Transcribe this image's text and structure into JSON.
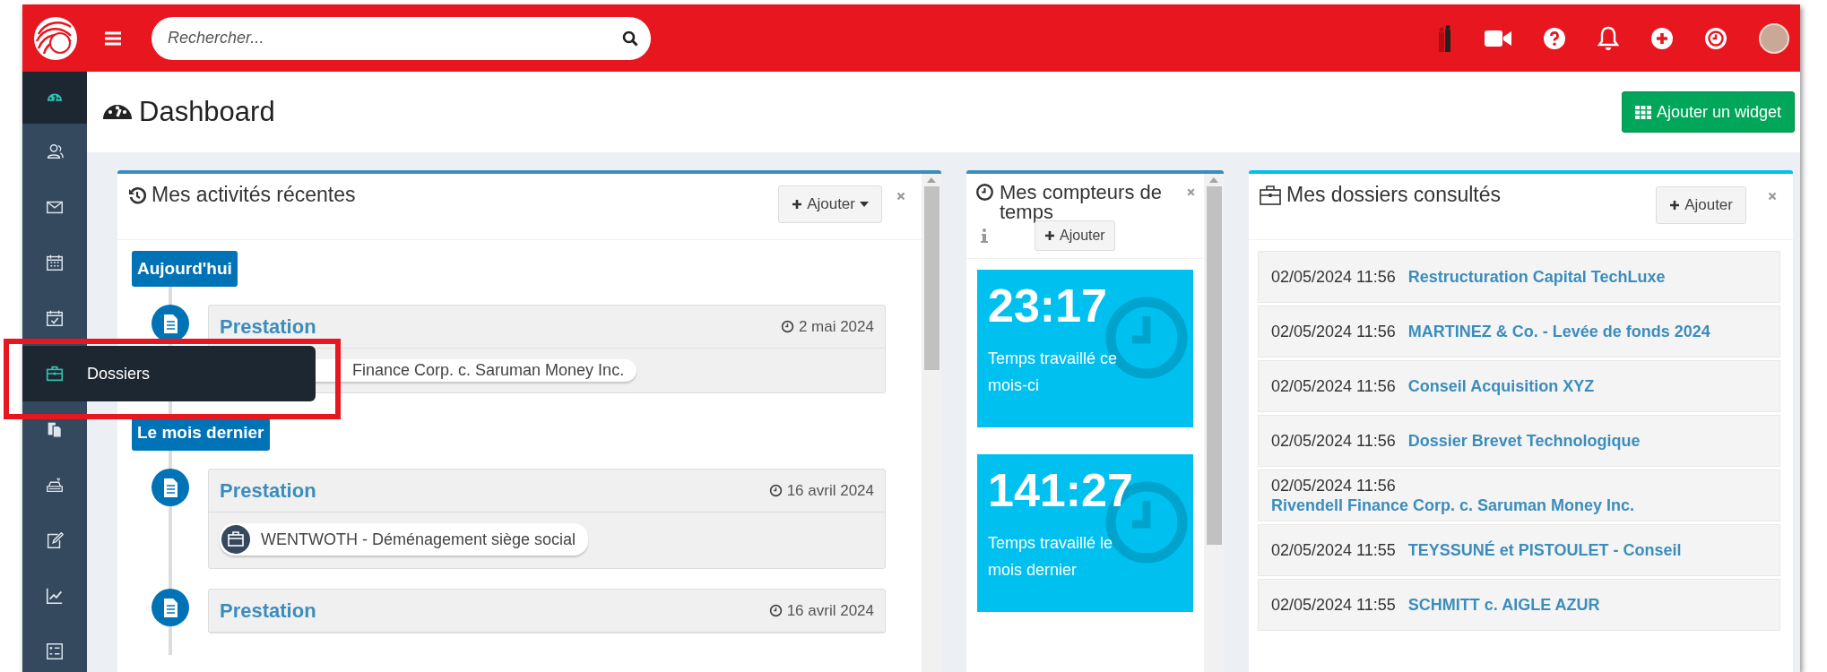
{
  "topbar": {
    "search": {
      "placeholder": "Rechercher..."
    }
  },
  "sidebar": {
    "items": [
      {
        "kind": "dashboard",
        "selected": true,
        "hovered": false
      },
      {
        "kind": "contacts",
        "selected": false,
        "hovered": false
      },
      {
        "kind": "mail",
        "selected": false,
        "hovered": false
      },
      {
        "kind": "calendar",
        "selected": false,
        "hovered": false
      },
      {
        "kind": "tasks",
        "selected": false,
        "hovered": false
      },
      {
        "kind": "dossiers",
        "selected": false,
        "hovered": true,
        "tooltip": "Dossiers"
      },
      {
        "kind": "documents",
        "selected": false,
        "hovered": false
      },
      {
        "kind": "billing",
        "selected": false,
        "hovered": false
      },
      {
        "kind": "notes",
        "selected": false,
        "hovered": false
      },
      {
        "kind": "reports",
        "selected": false,
        "hovered": false
      },
      {
        "kind": "list",
        "selected": false,
        "hovered": false
      }
    ]
  },
  "page": {
    "title": "Dashboard",
    "add_widget_button": "Ajouter un widget"
  },
  "recent_activities": {
    "title": "Mes activités récentes",
    "add_button": {
      "label": "Ajouter",
      "dropdown": true
    },
    "groups": [
      {
        "label": "Aujourd'hui",
        "items": [
          {
            "title": "Prestation",
            "date": "2 mai 2024",
            "tag": "Finance Corp. c. Saruman Money Inc."
          }
        ]
      },
      {
        "label": "Le mois dernier",
        "items": [
          {
            "title": "Prestation",
            "date": "16 avril 2024",
            "tag": "WENTWOTH - Déménagement siège social"
          },
          {
            "title": "Prestation",
            "date": "16 avril 2024"
          }
        ]
      }
    ]
  },
  "time_counters": {
    "title": "Mes compteurs de temps",
    "add_button": {
      "label": "Ajouter",
      "dropdown": false
    },
    "counters": [
      {
        "value": "23:17",
        "label": "Temps travaillé ce mois-ci"
      },
      {
        "value": "141:27",
        "label": "Temps travaillé le mois dernier"
      }
    ]
  },
  "viewed_dossiers": {
    "title": "Mes dossiers consultés",
    "add_button": {
      "label": "Ajouter",
      "dropdown": false
    },
    "rows": [
      {
        "date": "02/05/2024 11:56",
        "name": "Restructuration Capital TechLuxe"
      },
      {
        "date": "02/05/2024 11:56",
        "name": "MARTINEZ & Co. - Levée de fonds 2024"
      },
      {
        "date": "02/05/2024 11:56",
        "name": "Conseil Acquisition XYZ"
      },
      {
        "date": "02/05/2024 11:56",
        "name": "Dossier Brevet Technologique"
      },
      {
        "date": "02/05/2024 11:56",
        "name": "Rivendell Finance Corp. c. Saruman Money Inc."
      },
      {
        "date": "02/05/2024 11:55",
        "name": "TEYSSUNÉ et PISTOULET - Conseil"
      },
      {
        "date": "02/05/2024 11:55",
        "name": "SCHMITT c. AIGLE AZUR"
      }
    ]
  }
}
